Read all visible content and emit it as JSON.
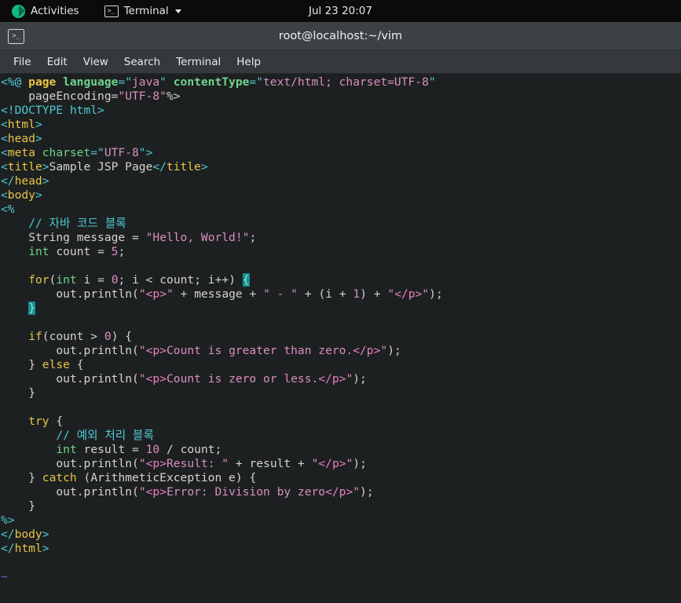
{
  "topbar": {
    "activities_label": "Activities",
    "activities_icon": "rocky-linux-logo-icon",
    "app_menu_label": "Terminal",
    "app_menu_icon": "terminal-icon",
    "dropdown_icon": "chevron-down-icon",
    "clock": "Jul 23  20:07"
  },
  "window": {
    "icon": "terminal-icon",
    "title": "root@localhost:~/vim",
    "menus": [
      {
        "label": "File"
      },
      {
        "label": "Edit"
      },
      {
        "label": "View"
      },
      {
        "label": "Search"
      },
      {
        "label": "Terminal"
      },
      {
        "label": "Help"
      }
    ]
  },
  "editor": {
    "app": "vim",
    "filetype": "jsp",
    "colors": {
      "background": "#1d2021",
      "tag_delimiter": "#4ec9d4",
      "tag_name": "#e8c547",
      "attribute": "#6fd48a",
      "string": "#d98fc0",
      "comment": "#4ec9d4",
      "keyword": "#e8c547",
      "type": "#6fd48a",
      "number": "#d98fc0",
      "plain_text": "#d7d3c8",
      "nontext": "#4a6fb5",
      "matchparen_bg": "#158f92"
    },
    "lines": [
      {
        "n": 1,
        "text": "<%@ page language=\"java\" contentType=\"text/html; charset=UTF-8\""
      },
      {
        "n": 2,
        "text": "    pageEncoding=\"UTF-8\"%>"
      },
      {
        "n": 3,
        "text": "<!DOCTYPE html>"
      },
      {
        "n": 4,
        "text": "<html>"
      },
      {
        "n": 5,
        "text": "<head>"
      },
      {
        "n": 6,
        "text": "<meta charset=\"UTF-8\">"
      },
      {
        "n": 7,
        "text": "<title>Sample JSP Page</title>"
      },
      {
        "n": 8,
        "text": "</head>"
      },
      {
        "n": 9,
        "text": "<body>"
      },
      {
        "n": 10,
        "text": "<%"
      },
      {
        "n": 11,
        "text": "    // 자바 코드 블록"
      },
      {
        "n": 12,
        "text": "    String message = \"Hello, World!\";"
      },
      {
        "n": 13,
        "text": "    int count = 5;"
      },
      {
        "n": 14,
        "text": ""
      },
      {
        "n": 15,
        "text": "    for(int i = 0; i < count; i++) {"
      },
      {
        "n": 16,
        "text": "        out.println(\"<p>\" + message + \" - \" + (i + 1) + \"</p>\");"
      },
      {
        "n": 17,
        "text": "    }"
      },
      {
        "n": 18,
        "text": ""
      },
      {
        "n": 19,
        "text": "    if(count > 0) {"
      },
      {
        "n": 20,
        "text": "        out.println(\"<p>Count is greater than zero.</p>\");"
      },
      {
        "n": 21,
        "text": "    } else {"
      },
      {
        "n": 22,
        "text": "        out.println(\"<p>Count is zero or less.</p>\");"
      },
      {
        "n": 23,
        "text": "    }"
      },
      {
        "n": 24,
        "text": ""
      },
      {
        "n": 25,
        "text": "    try {"
      },
      {
        "n": 26,
        "text": "        // 예외 처리 블록"
      },
      {
        "n": 27,
        "text": "        int result = 10 / count;"
      },
      {
        "n": 28,
        "text": "        out.println(\"<p>Result: \" + result + \"</p>\");"
      },
      {
        "n": 29,
        "text": "    } catch (ArithmeticException e) {"
      },
      {
        "n": 30,
        "text": "        out.println(\"<p>Error: Division by zero</p>\");"
      },
      {
        "n": 31,
        "text": "    }"
      },
      {
        "n": 32,
        "text": "%>"
      },
      {
        "n": 33,
        "text": "</body>"
      },
      {
        "n": 34,
        "text": "</html>"
      },
      {
        "n": 35,
        "text": ""
      },
      {
        "n": 36,
        "text": "~"
      }
    ],
    "matched_braces": [
      "{ on line 15",
      "} on line 17"
    ],
    "filler_char": "~"
  }
}
